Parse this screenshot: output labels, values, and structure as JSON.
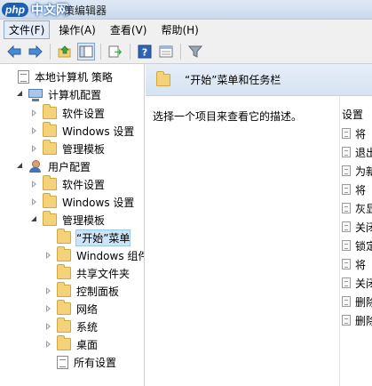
{
  "window": {
    "watermark_badge": "php",
    "watermark_text": "中文网",
    "title": "策编辑器"
  },
  "menubar": {
    "items": [
      {
        "label": "文件(F)",
        "active": true
      },
      {
        "label": "操作(A)",
        "active": false
      },
      {
        "label": "查看(V)",
        "active": false
      },
      {
        "label": "帮助(H)",
        "active": false
      }
    ]
  },
  "toolbar": {
    "buttons": [
      "back-icon",
      "forward-icon",
      "up-folder-icon",
      "show-hide-tree-icon",
      "export-list-icon",
      "help-icon",
      "properties-icon",
      "filter-icon"
    ]
  },
  "tree": {
    "items": [
      {
        "label": "本地计算机 策略",
        "level": 0,
        "arrow": "none",
        "icon": "policy"
      },
      {
        "label": "计算机配置",
        "level": 1,
        "arrow": "expanded",
        "icon": "computer"
      },
      {
        "label": "软件设置",
        "level": 2,
        "arrow": "collapsed",
        "icon": "folder"
      },
      {
        "label": "Windows 设置",
        "level": 2,
        "arrow": "collapsed",
        "icon": "folder"
      },
      {
        "label": "管理模板",
        "level": 2,
        "arrow": "collapsed",
        "icon": "folder"
      },
      {
        "label": "用户配置",
        "level": 1,
        "arrow": "expanded",
        "icon": "user"
      },
      {
        "label": "软件设置",
        "level": 2,
        "arrow": "collapsed",
        "icon": "folder"
      },
      {
        "label": "Windows 设置",
        "level": 2,
        "arrow": "collapsed",
        "icon": "folder"
      },
      {
        "label": "管理模板",
        "level": 2,
        "arrow": "expanded",
        "icon": "folder"
      },
      {
        "label": "“开始”菜单",
        "level": 3,
        "arrow": "none",
        "icon": "folder",
        "selected": true
      },
      {
        "label": "Windows 组件",
        "level": 3,
        "arrow": "collapsed",
        "icon": "folder"
      },
      {
        "label": "共享文件夹",
        "level": 3,
        "arrow": "none",
        "icon": "folder"
      },
      {
        "label": "控制面板",
        "level": 3,
        "arrow": "collapsed",
        "icon": "folder"
      },
      {
        "label": "网络",
        "level": 3,
        "arrow": "collapsed",
        "icon": "folder"
      },
      {
        "label": "系统",
        "level": 3,
        "arrow": "collapsed",
        "icon": "folder"
      },
      {
        "label": "桌面",
        "level": 3,
        "arrow": "collapsed",
        "icon": "folder"
      },
      {
        "label": "所有设置",
        "level": 3,
        "arrow": "none",
        "icon": "policy"
      }
    ]
  },
  "main": {
    "header_title": "“开始”菜单和任务栏",
    "description": "选择一个项目来查看它的描述。",
    "settings_header": "设置",
    "settings": [
      "将",
      "退出",
      "为新",
      "将",
      "灰显",
      "关闭",
      "锁定",
      "将",
      "关闭",
      "删除",
      "删除"
    ]
  }
}
